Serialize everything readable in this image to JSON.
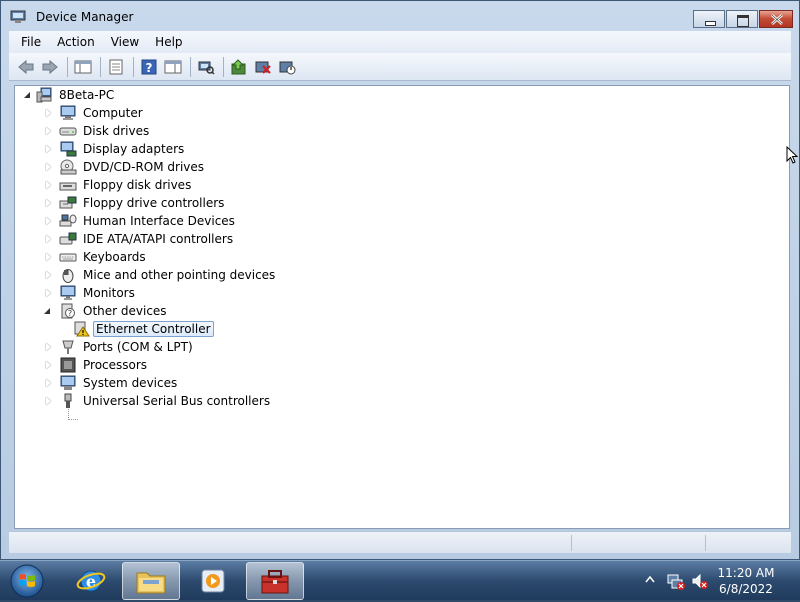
{
  "window": {
    "title": "Device Manager"
  },
  "menu": [
    "File",
    "Action",
    "View",
    "Help"
  ],
  "toolbar": {
    "buttons": [
      "back-icon",
      "forward-icon",
      "show-hide-tree-icon",
      "properties-icon",
      "help-icon",
      "console-tree-icon",
      "scan-hardware-icon",
      "update-driver-icon",
      "uninstall-icon",
      "disable-icon"
    ]
  },
  "tree": {
    "root": "8Beta-PC",
    "categories": [
      {
        "label": "Computer",
        "icon": "computer-icon"
      },
      {
        "label": "Disk drives",
        "icon": "disk-drive-icon"
      },
      {
        "label": "Display adapters",
        "icon": "display-adapter-icon"
      },
      {
        "label": "DVD/CD-ROM drives",
        "icon": "dvd-drive-icon"
      },
      {
        "label": "Floppy disk drives",
        "icon": "floppy-drive-icon"
      },
      {
        "label": "Floppy drive controllers",
        "icon": "floppy-controller-icon"
      },
      {
        "label": "Human Interface Devices",
        "icon": "hid-icon"
      },
      {
        "label": "IDE ATA/ATAPI controllers",
        "icon": "ide-controller-icon"
      },
      {
        "label": "Keyboards",
        "icon": "keyboard-icon"
      },
      {
        "label": "Mice and other pointing devices",
        "icon": "mouse-icon"
      },
      {
        "label": "Monitors",
        "icon": "monitor-icon"
      },
      {
        "label": "Other devices",
        "icon": "other-devices-icon"
      },
      {
        "label": "Ports (COM & LPT)",
        "icon": "port-icon"
      },
      {
        "label": "Processors",
        "icon": "processor-icon"
      },
      {
        "label": "System devices",
        "icon": "system-device-icon"
      },
      {
        "label": "Universal Serial Bus controllers",
        "icon": "usb-icon"
      }
    ],
    "other_devices_child": "Ethernet Controller"
  },
  "taskbar": {
    "time": "11:20 AM",
    "date": "6/8/2022"
  }
}
